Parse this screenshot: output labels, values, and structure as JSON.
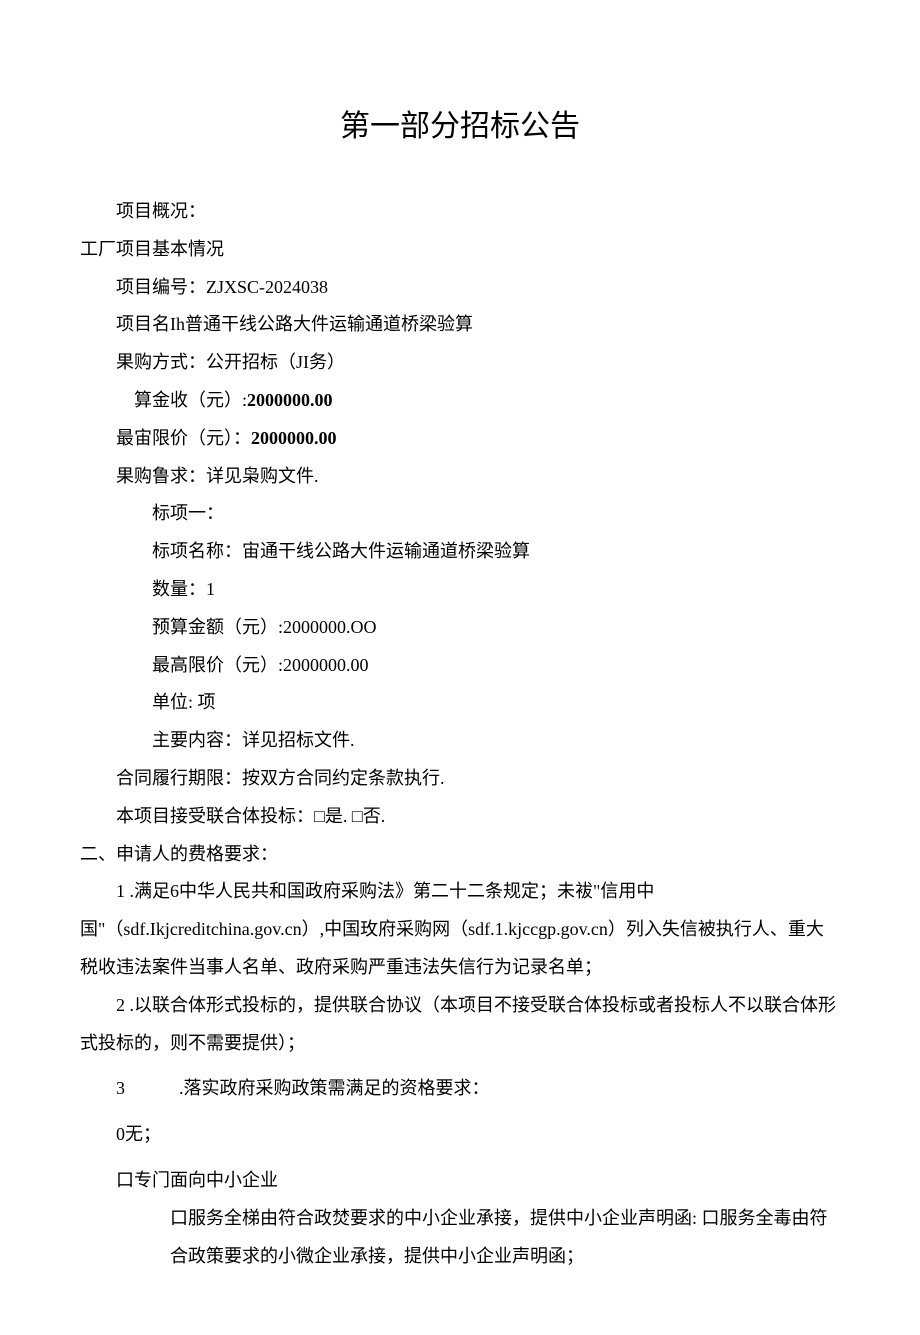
{
  "title": "第一部分招标公告",
  "overview_label": "项目概况：",
  "section1_heading": "工厂项目基本情况",
  "project_number_label": "项目编号：",
  "project_number": "ZJXSC-2024038",
  "project_name_line": "项目名Ih普通干线公路大件运输通道桥梁验算",
  "procurement_method_line": "果购方式：公开招标（JI务）",
  "budget_label": "算金收（元）:",
  "budget_value": "2000000.00",
  "max_price_label": "最宙限价（元）：",
  "max_price_value": "2000000.00",
  "requirement_line": "果购鲁求：详见枭购文件.",
  "lot": {
    "heading": "标项一：",
    "name_line": "标项名称：宙通干线公路大件运输通道桥梁验算",
    "quantity_line": "数量：1",
    "budget_line": "预算金额（元）:2000000.OO",
    "max_price_line": "最高限价（元）:2000000.00",
    "unit_line": "单位: 项",
    "content_line": "主要内容：详见招标文件."
  },
  "contract_period_line": "合同履行期限：按双方合同约定条款执行.",
  "consortium_line": "本项目接受联合体投标：□是. □否.",
  "section2_heading": "二、申请人的费格要求：",
  "req1": "1 .满足6中华人民共和国政府采购法》第二十二条规定；未袚\"信用中国\"（sdf.Ikjcreditchina.gov.cn）,中国玫府采购网（sdf.1.kjccgp.gov.cn）列入失信被执行人、重大税收违法案件当事人名单、政府采购严重违法失信行为记录名单；",
  "req2": "2 .以联合体形式投标的，提供联合协议（本项目不接受联合体投标或者投标人不以联合体形式投标的，则不需要提供）；",
  "req3_num": "3",
  "req3_text": ".落实政府采购政策需满足的资格要求：",
  "req3_none": "0无；",
  "req3_sme_heading": "口专门面向中小企业",
  "req3_sme_body": "口服务全梯由符合政焚要求的中小企业承接，提供中小企业声明函: 口服务全毒由符合政策要求的小微企业承接，提供中小企业声明函；"
}
